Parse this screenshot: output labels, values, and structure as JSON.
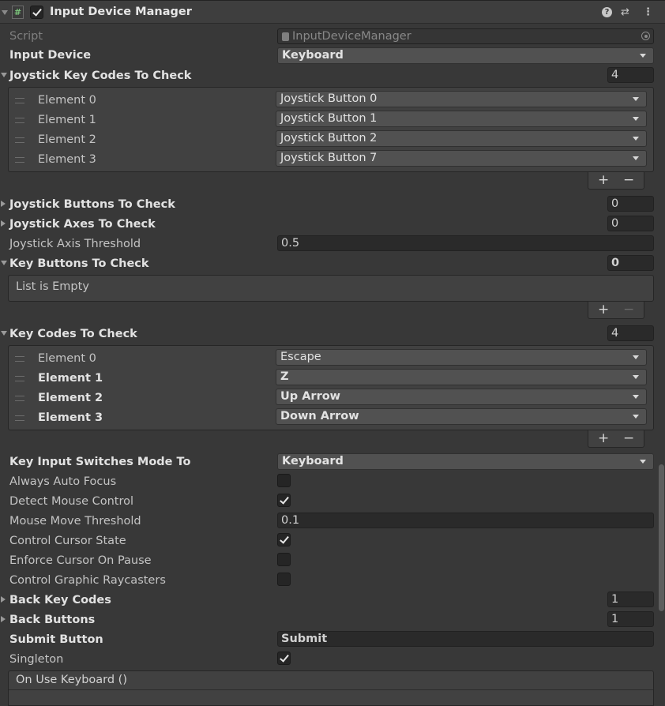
{
  "component": {
    "title": "Input Device Manager",
    "enabled": true,
    "script_icon": "#",
    "header_icons": [
      "help-icon",
      "preset-icon",
      "kebab-menu-icon"
    ]
  },
  "script": {
    "label": "Script",
    "value": "InputDeviceManager"
  },
  "input_device": {
    "label": "Input Device",
    "value": "Keyboard"
  },
  "joystick_key_codes": {
    "label": "Joystick Key Codes To Check",
    "count": "4",
    "elements": [
      {
        "label": "Element 0",
        "value": "Joystick Button 0"
      },
      {
        "label": "Element 1",
        "value": "Joystick Button 1"
      },
      {
        "label": "Element 2",
        "value": "Joystick Button 2"
      },
      {
        "label": "Element 3",
        "value": "Joystick Button 7"
      }
    ]
  },
  "joystick_buttons": {
    "label": "Joystick Buttons To Check",
    "count": "0"
  },
  "joystick_axes": {
    "label": "Joystick Axes To Check",
    "count": "0"
  },
  "joystick_axis_threshold": {
    "label": "Joystick Axis Threshold",
    "value": "0.5"
  },
  "key_buttons": {
    "label": "Key Buttons To Check",
    "count": "0",
    "empty_text": "List is Empty"
  },
  "key_codes": {
    "label": "Key Codes To Check",
    "count": "4",
    "elements": [
      {
        "label": "Element 0",
        "value": "Escape"
      },
      {
        "label": "Element 1",
        "value": "Z"
      },
      {
        "label": "Element 2",
        "value": "Up Arrow"
      },
      {
        "label": "Element 3",
        "value": "Down Arrow"
      }
    ]
  },
  "key_input_switches_mode_to": {
    "label": "Key Input Switches Mode To",
    "value": "Keyboard"
  },
  "always_auto_focus": {
    "label": "Always Auto Focus",
    "checked": false
  },
  "detect_mouse_control": {
    "label": "Detect Mouse Control",
    "checked": true
  },
  "mouse_move_threshold": {
    "label": "Mouse Move Threshold",
    "value": "0.1"
  },
  "control_cursor_state": {
    "label": "Control Cursor State",
    "checked": true
  },
  "enforce_cursor_on_pause": {
    "label": "Enforce Cursor On Pause",
    "checked": false
  },
  "control_graphic_raycasters": {
    "label": "Control Graphic Raycasters",
    "checked": false
  },
  "back_key_codes": {
    "label": "Back Key Codes",
    "count": "1"
  },
  "back_buttons": {
    "label": "Back Buttons",
    "count": "1"
  },
  "submit_button": {
    "label": "Submit Button",
    "value": "Submit"
  },
  "singleton": {
    "label": "Singleton",
    "checked": true
  },
  "on_use_keyboard": {
    "label": "On Use Keyboard ()"
  },
  "list_footer": {
    "add": "+",
    "remove": "−"
  }
}
